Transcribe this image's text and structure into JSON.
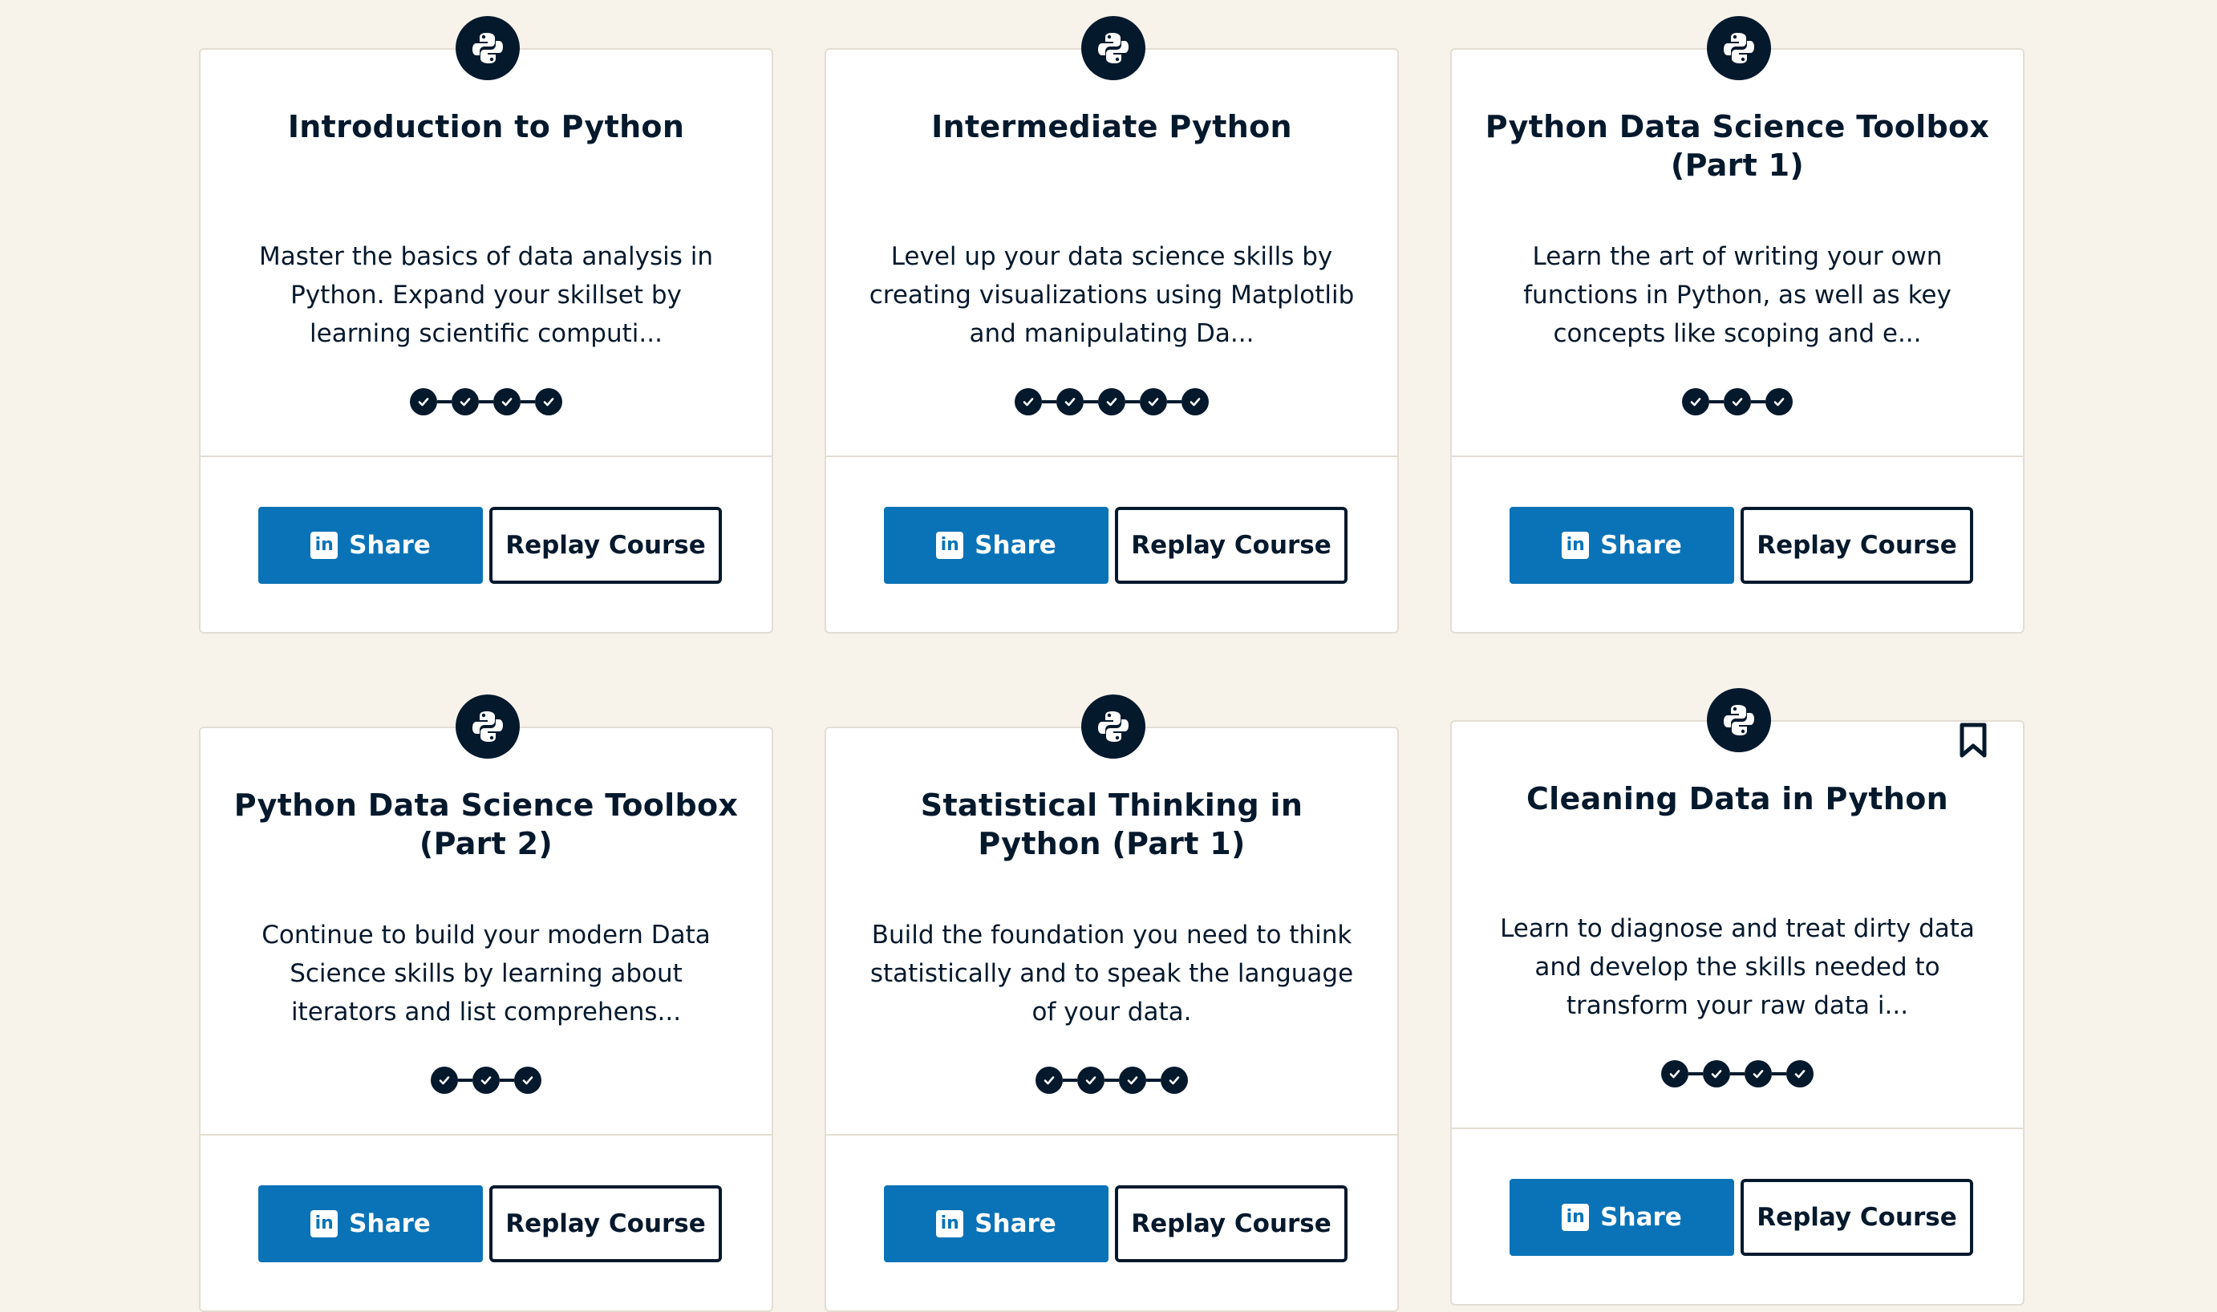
{
  "accent": "#05192d",
  "share_color": "#0a73b7",
  "courses": [
    {
      "title": "Introduction to Python",
      "description": "Master the basics of data analysis in Python. Expand your skillset by learning scientific computi...",
      "chapters_completed": 4,
      "icon": "python-icon",
      "share_label": "Share",
      "replay_label": "Replay Course",
      "bookmark": false
    },
    {
      "title": "Intermediate Python",
      "description": "Level up your data science skills by creating visualizations using Matplotlib and manipulating Da...",
      "chapters_completed": 5,
      "icon": "python-icon",
      "share_label": "Share",
      "replay_label": "Replay Course",
      "bookmark": false
    },
    {
      "title": "Python Data Science Toolbox (Part 1)",
      "description": "Learn the art of writing your own functions in Python, as well as key concepts like scoping and e...",
      "chapters_completed": 3,
      "icon": "python-icon",
      "share_label": "Share",
      "replay_label": "Replay Course",
      "bookmark": false
    },
    {
      "title": "Python Data Science Toolbox (Part 2)",
      "description": "Continue to build your modern Data Science skills by learning about iterators and list comprehens...",
      "chapters_completed": 3,
      "icon": "python-icon",
      "share_label": "Share",
      "replay_label": "Replay Course",
      "bookmark": false
    },
    {
      "title": "Statistical Thinking in Python (Part 1)",
      "description": "Build the foundation you need to think statistically and to speak the language of your data.",
      "chapters_completed": 4,
      "icon": "python-icon",
      "share_label": "Share",
      "replay_label": "Replay Course",
      "bookmark": false
    },
    {
      "title": "Cleaning Data in Python",
      "description": "Learn to diagnose and treat dirty data and develop the skills needed to transform your raw data i...",
      "chapters_completed": 4,
      "icon": "python-icon",
      "share_label": "Share",
      "replay_label": "Replay Course",
      "bookmark": true
    }
  ]
}
